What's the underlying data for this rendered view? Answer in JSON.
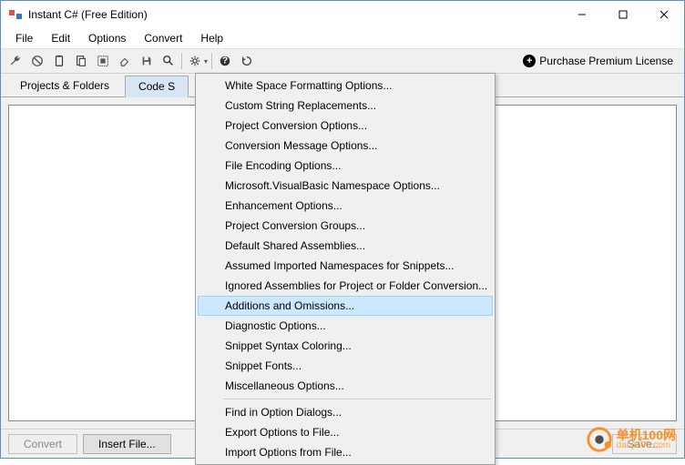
{
  "window": {
    "title": "Instant C# (Free Edition)"
  },
  "menubar": [
    "File",
    "Edit",
    "Options",
    "Convert",
    "Help"
  ],
  "toolbar": {
    "purchase_label": "Purchase Premium License"
  },
  "tabs": [
    {
      "label": "Projects & Folders",
      "active": false
    },
    {
      "label": "Code Snippets",
      "active": true,
      "truncated": "Code S"
    }
  ],
  "dropdown": {
    "items": [
      "White Space Formatting Options...",
      "Custom String Replacements...",
      "Project Conversion Options...",
      "Conversion Message Options...",
      "File Encoding Options...",
      "Microsoft.VisualBasic Namespace Options...",
      "Enhancement Options...",
      "Project Conversion Groups...",
      "Default Shared Assemblies...",
      "Assumed Imported Namespaces for Snippets...",
      "Ignored Assemblies for Project or Folder Conversion...",
      "Additions and Omissions...",
      "Diagnostic Options...",
      "Snippet Syntax Coloring...",
      "Snippet Fonts...",
      "Miscellaneous Options..."
    ],
    "highlighted_index": 11,
    "items2": [
      "Find in Option Dialogs...",
      "Export Options to File...",
      "Import Options from File..."
    ]
  },
  "bottom": {
    "convert": "Convert",
    "insert_file": "Insert File...",
    "save": "Save..."
  },
  "watermark": {
    "cn": "单机100网",
    "url": "danji100.com"
  }
}
